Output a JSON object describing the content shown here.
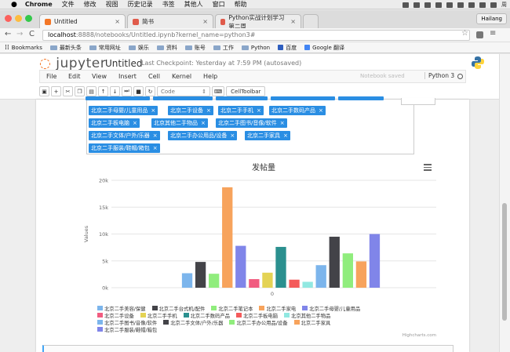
{
  "mac_menu": {
    "app": "Chrome",
    "items": [
      "文件",
      "修改",
      "视图",
      "历史记录",
      "书签",
      "其他人",
      "窗口",
      "帮助"
    ],
    "right_text": "周"
  },
  "browser": {
    "tabs": [
      {
        "label": "Untitled",
        "active": true
      },
      {
        "label": "简书",
        "active": false
      },
      {
        "label": "Python实战计划学习第二周",
        "active": false
      }
    ],
    "user": "Hailang",
    "url_host": "localhost",
    "url_rest": ":8888/notebooks/Untitled.ipynb?kernel_name=python3#",
    "bookmarks": [
      "Bookmarks",
      "最新头条",
      "常用网址",
      "娱乐",
      "资料",
      "账号",
      "工作",
      "Python",
      "百度",
      "Google 翻译"
    ]
  },
  "notebook": {
    "logo_text": "jupyter",
    "title": "Untitled",
    "checkpoint": "Last Checkpoint: Yesterday at 7:59 PM (autosaved)",
    "menu": [
      "File",
      "Edit",
      "View",
      "Insert",
      "Cell",
      "Kernel",
      "Help"
    ],
    "saved_status": "Notebook saved",
    "kernel": "Python 3",
    "cell_type": "Code",
    "celltoolbar": "CellToolbar"
  },
  "tags": [
    "北京二手母婴/儿童用品",
    "北京二手设备",
    "北京二手手机",
    "北京二手数码产品",
    "北京二手板电脑",
    "北京其他二手物品",
    "北京二手图书/音像/软件",
    "北京二手文体/户外/乐器",
    "北京二手办公用品/设备",
    "北京二手家具",
    "北京二手服装/鞋帽/箱包"
  ],
  "chart_data": {
    "type": "bar",
    "title": "发帖量",
    "ylabel": "Values",
    "xlabel": "",
    "categories": [
      "0"
    ],
    "ylim": [
      0,
      20000
    ],
    "yticks": [
      "0k",
      "5k",
      "10k",
      "15k",
      "20k"
    ],
    "grid": true,
    "legend_position": "bottom",
    "series": [
      {
        "name": "北京二手美容/保健",
        "values": [
          2700
        ],
        "color": "#7cb5ec"
      },
      {
        "name": "北京二手台式机/配件",
        "values": [
          4800
        ],
        "color": "#434348"
      },
      {
        "name": "北京二手笔记本",
        "values": [
          2600
        ],
        "color": "#90ed7d"
      },
      {
        "name": "北京二手家电",
        "values": [
          18700
        ],
        "color": "#f7a35c"
      },
      {
        "name": "北京二手母婴/儿童用品",
        "values": [
          7800
        ],
        "color": "#8085e9"
      },
      {
        "name": "北京二手设备",
        "values": [
          1600
        ],
        "color": "#f15c80"
      },
      {
        "name": "北京二手手机",
        "values": [
          2800
        ],
        "color": "#e4d354"
      },
      {
        "name": "北京二手数码产品",
        "values": [
          7600
        ],
        "color": "#2b908f"
      },
      {
        "name": "北京二手板电脑",
        "values": [
          1500
        ],
        "color": "#f45b5b"
      },
      {
        "name": "北京其他二手物品",
        "values": [
          1100
        ],
        "color": "#91e8e1"
      },
      {
        "name": "北京二手图书/音像/软件",
        "values": [
          4200
        ],
        "color": "#7cb5ec"
      },
      {
        "name": "北京二手文体/户外/乐器",
        "values": [
          9500
        ],
        "color": "#434348"
      },
      {
        "name": "北京二手办公用品/设备",
        "values": [
          6400
        ],
        "color": "#90ed7d"
      },
      {
        "name": "北京二手家具",
        "values": [
          4900
        ],
        "color": "#f7a35c"
      },
      {
        "name": "北京二手服装/鞋帽/箱包",
        "values": [
          10000
        ],
        "color": "#8085e9"
      }
    ],
    "credits": "Highcharts.com"
  }
}
